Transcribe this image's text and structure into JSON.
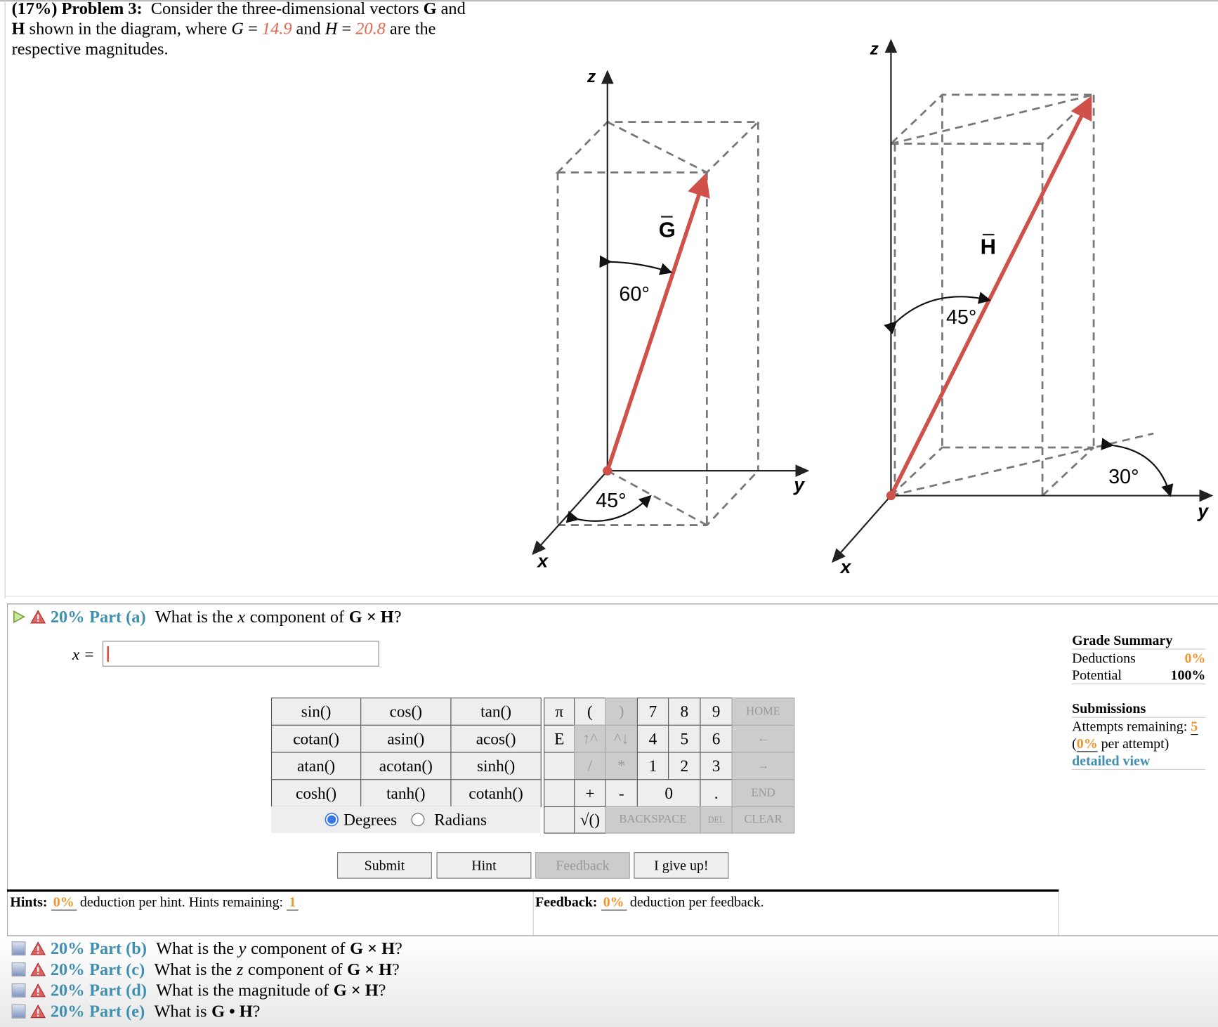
{
  "problem": {
    "weight": "(17%)",
    "title": "Problem 3:",
    "text1": "Consider the three-dimensional vectors",
    "vec_g": "G",
    "and": "and",
    "vec_h": "H",
    "text2": "shown in the diagram, where",
    "g_sym": "G",
    "eq": "=",
    "g_val": "14.9",
    "and2": "and",
    "h_sym": "H",
    "h_val": "20.8",
    "text3": "are",
    "text4": "the respective magnitudes."
  },
  "diagram": {
    "left": {
      "z": "z",
      "y": "y",
      "x": "x",
      "vector": "G",
      "angle_z": "60°",
      "angle_xy": "45°"
    },
    "right": {
      "z": "z",
      "y": "y",
      "x": "x",
      "vector": "H",
      "angle_z": "45°",
      "angle_xy": "30°"
    },
    "vector_color": "#d0504a"
  },
  "part_a": {
    "percent": "20%",
    "label": "Part (a)",
    "question_pre": "What is the",
    "var": "x",
    "question_post": "component of",
    "expr": "G × H",
    "q": "?",
    "input_label": "x =",
    "input_value": ""
  },
  "keypad": {
    "functions": [
      "sin()",
      "cos()",
      "tan()",
      "cotan()",
      "asin()",
      "acos()",
      "atan()",
      "acotan()",
      "sinh()",
      "cosh()",
      "tanh()",
      "cotanh()"
    ],
    "degrees": "Degrees",
    "radians": "Radians",
    "selected_unit": "Degrees",
    "keys": {
      "pi": "π",
      "lparen": "(",
      "rparen": ")",
      "e": "E",
      "up": "↑^",
      "down": "^↓",
      "div": "/",
      "mul": "*",
      "plus": "+",
      "minus": "-",
      "sqrt": "√()",
      "dot": ".",
      "d0": "0",
      "d1": "1",
      "d2": "2",
      "d3": "3",
      "d4": "4",
      "d5": "5",
      "d6": "6",
      "d7": "7",
      "d8": "8",
      "d9": "9",
      "home": "HOME",
      "left": "←",
      "right": "→",
      "end": "END",
      "backspace": "BACKSPACE",
      "del": "DEL",
      "clear": "CLEAR"
    }
  },
  "buttons": {
    "submit": "Submit",
    "hint": "Hint",
    "feedback": "Feedback",
    "giveup": "I give up!"
  },
  "hints": {
    "label": "Hints:",
    "deduction": "0%",
    "text": "deduction per hint. Hints remaining:",
    "remaining": "1"
  },
  "feedback": {
    "label": "Feedback:",
    "deduction": "0%",
    "text": "deduction per feedback."
  },
  "grade": {
    "title": "Grade Summary",
    "deductions_label": "Deductions",
    "deductions": "0%",
    "potential_label": "Potential",
    "potential": "100%",
    "submissions_title": "Submissions",
    "attempts_label": "Attempts remaining:",
    "attempts": "5",
    "per_open": "(",
    "per_value": "0%",
    "per_close": "per attempt)",
    "detailed": "detailed view"
  },
  "parts": [
    {
      "percent": "20%",
      "label": "Part (b)",
      "pre": "What is the",
      "var": "y",
      "post": "component of",
      "expr": "G × H",
      "q": "?"
    },
    {
      "percent": "20%",
      "label": "Part (c)",
      "pre": "What is the",
      "var": "z",
      "post": "component of",
      "expr": "G × H",
      "q": "?"
    },
    {
      "percent": "20%",
      "label": "Part (d)",
      "pre": "What is the magnitude of",
      "var": "",
      "post": "",
      "expr": "G × H",
      "q": "?"
    },
    {
      "percent": "20%",
      "label": "Part (e)",
      "pre": "What is",
      "var": "",
      "post": "",
      "expr": "G • H",
      "q": "?"
    }
  ]
}
